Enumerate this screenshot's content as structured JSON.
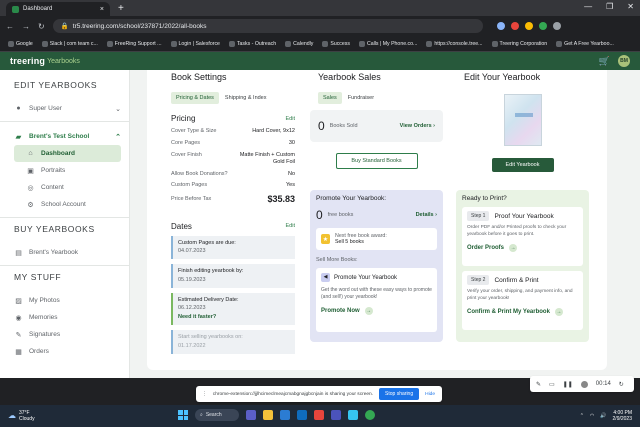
{
  "browser": {
    "tab_title": "Dashboard",
    "url": "tr5.treering.com/school/237871/2022/all-books",
    "bookmarks": [
      "Google",
      "Slack | com team c...",
      "FreeRing Support ...",
      "Login | Salesforce",
      "Tasks - Outreach",
      "Calendly",
      "Success",
      "Calls | My Phone.co...",
      "https://console.tree...",
      "Treering Corporation",
      "Get A Free Yearboo..."
    ]
  },
  "app": {
    "logo": "treering",
    "logo_sub": "Yearbooks",
    "avatar": "BM"
  },
  "sidebar": {
    "edit_heading": "EDIT YEARBOOKS",
    "super_user": "Super User",
    "school": "Brent's Test School",
    "items": [
      {
        "label": "Dashboard",
        "icon": "home-icon"
      },
      {
        "label": "Portraits",
        "icon": "portrait-icon"
      },
      {
        "label": "Content",
        "icon": "content-icon"
      },
      {
        "label": "School Account",
        "icon": "account-icon"
      }
    ],
    "buy_heading": "BUY YEARBOOKS",
    "buy_item": "Brent's Yearbook",
    "stuff_heading": "MY STUFF",
    "stuff_items": [
      {
        "label": "My Photos",
        "icon": "photos-icon"
      },
      {
        "label": "Memories",
        "icon": "memories-icon"
      },
      {
        "label": "Signatures",
        "icon": "signatures-icon"
      },
      {
        "label": "Orders",
        "icon": "orders-icon"
      }
    ]
  },
  "settings": {
    "title": "Book Settings",
    "tab_active": "Pricing & Dates",
    "tab_other": "Shipping & Index",
    "pricing_heading": "Pricing",
    "edit": "Edit",
    "rows": [
      {
        "label": "Cover Type & Size",
        "value": "Hard Cover, 9x12"
      },
      {
        "label": "Core Pages",
        "value": "30"
      },
      {
        "label": "Cover Finish",
        "value": "Matte Finish + Custom Gold Foil"
      },
      {
        "label": "Allow Book Donations?",
        "value": "No"
      },
      {
        "label": "Custom Pages",
        "value": "Yes"
      }
    ],
    "price_label": "Price Before Tax",
    "price_value": "$35.83",
    "dates_heading": "Dates",
    "dates": [
      {
        "label": "Custom Pages are due:",
        "value": "04.07.2023"
      },
      {
        "label": "Finish editing yearbook by:",
        "value": "05.19.2023"
      },
      {
        "label": "Estimated Delivery Date:",
        "value": "06.12.2023",
        "link": "Need it faster?"
      },
      {
        "label": "Start selling yearbooks on:",
        "value": "01.17.2022"
      }
    ]
  },
  "sales": {
    "title": "Yearbook Sales",
    "tab_active": "Sales",
    "tab_other": "Fundraiser",
    "sold_count": "0",
    "sold_label": "Books Sold",
    "view_orders": "View Orders",
    "buy_standard": "Buy Standard Books",
    "promote_heading": "Promote Your Yearbook:",
    "free_count": "0",
    "free_label": "free books",
    "details": "Details",
    "award_label": "Next free book award:",
    "award_value": "Sell 5 books",
    "more_books": "Sell More Books:",
    "promo_title": "Promote Your Yearbook",
    "promo_text": "Get the word out with these easy ways to promote (and sell!) your yearbook!",
    "promote_now": "Promote Now"
  },
  "edit_yb": {
    "title": "Edit Your Yearbook",
    "edit_button": "Edit Yearbook",
    "ready_heading": "Ready to Print?",
    "steps": [
      {
        "tag": "Step 1",
        "name": "Proof Your Yearbook",
        "text": "Order PDF and/or Printed proofs to check your yearbook before it goes to print.",
        "link": "Order Proofs"
      },
      {
        "tag": "Step 2",
        "name": "Confirm & Print",
        "text": "Verify your order, shipping, and payment info, and print your yearbook!",
        "link": "Confirm & Print My Yearbook"
      }
    ]
  },
  "sharebar": {
    "text": "chrome-extension://jjlhcimeclmeajcmabgnajgbcnjain is sharing your screen.",
    "stop": "Stop sharing",
    "hide": "Hide"
  },
  "recorder": {
    "time": "00:14"
  },
  "taskbar": {
    "temp": "37°F",
    "condition": "Cloudy",
    "search": "Search",
    "time": "4:00 PM",
    "date": "2/9/2023"
  }
}
